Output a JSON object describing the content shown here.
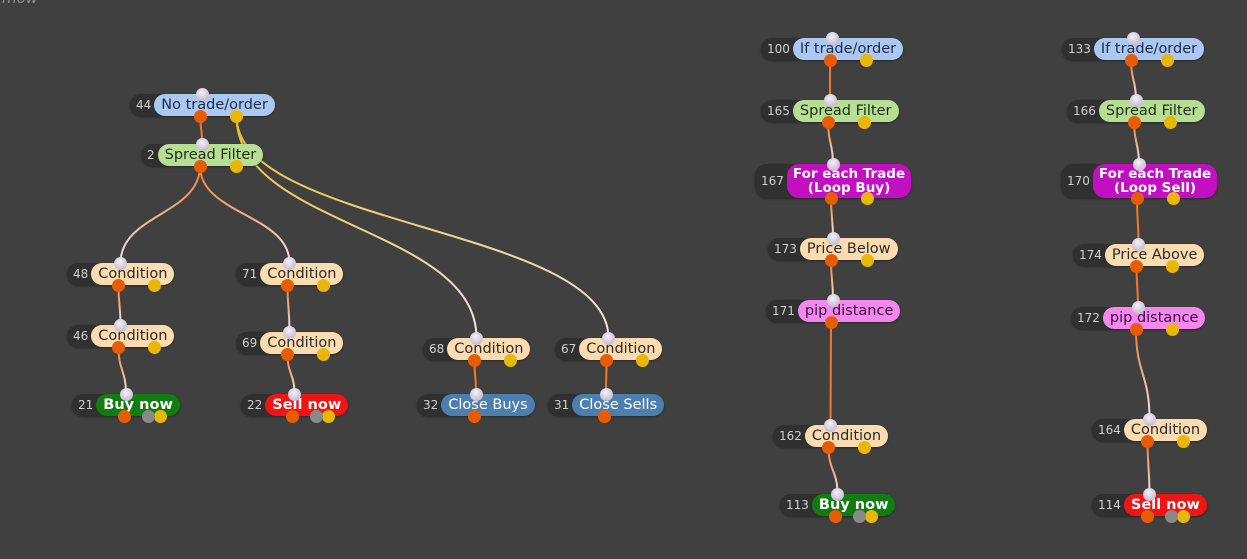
{
  "header": {
    "corner_text": "mow"
  },
  "colors": {
    "canvas": "#404040",
    "node_body": "#303030",
    "wire_main": "#f07a2c",
    "wire_alt": "#e8c020",
    "wire_tip": "#f2e6e6",
    "port_out": "#e85d04",
    "port_alt": "#e9b708"
  },
  "nodes": [
    {
      "key": "n44",
      "id": "44",
      "label": "No trade/order",
      "type": "trade-check",
      "bg": "#abc8f2",
      "fg": "#1f2a44",
      "ports": 2
    },
    {
      "key": "n2",
      "id": "2",
      "label": "Spread Filter",
      "type": "filter",
      "bg": "#b7de95",
      "fg": "#1d2e14",
      "ports": 2
    },
    {
      "key": "n48",
      "id": "48",
      "label": "Condition",
      "type": "condition",
      "bg": "#fbdcb0",
      "fg": "#2b2b2b",
      "ports": 2
    },
    {
      "key": "n46",
      "id": "46",
      "label": "Condition",
      "type": "condition",
      "bg": "#fbdcb0",
      "fg": "#2b2b2b",
      "ports": 2
    },
    {
      "key": "n21",
      "id": "21",
      "label": "Buy now",
      "type": "buy",
      "bg": "#117c11",
      "fg": "#ffffff",
      "bold": true,
      "ports": 3
    },
    {
      "key": "n71",
      "id": "71",
      "label": "Condition",
      "type": "condition",
      "bg": "#fbdcb0",
      "fg": "#2b2b2b",
      "ports": 2
    },
    {
      "key": "n69",
      "id": "69",
      "label": "Condition",
      "type": "condition",
      "bg": "#fbdcb0",
      "fg": "#2b2b2b",
      "ports": 2
    },
    {
      "key": "n22",
      "id": "22",
      "label": "Sell now",
      "type": "sell",
      "bg": "#f01414",
      "fg": "#ffffff",
      "bold": true,
      "ports": 3
    },
    {
      "key": "n68",
      "id": "68",
      "label": "Condition",
      "type": "condition",
      "bg": "#fbdcb0",
      "fg": "#2b2b2b",
      "ports": 2
    },
    {
      "key": "n32",
      "id": "32",
      "label": "Close Buys",
      "type": "close",
      "bg": "#4d7fae",
      "fg": "#ffffff",
      "ports": 1
    },
    {
      "key": "n67",
      "id": "67",
      "label": "Condition",
      "type": "condition",
      "bg": "#fbdcb0",
      "fg": "#2b2b2b",
      "ports": 2
    },
    {
      "key": "n31",
      "id": "31",
      "label": "Close Sells",
      "type": "close",
      "bg": "#4d7fae",
      "fg": "#ffffff",
      "ports": 1
    },
    {
      "key": "n100",
      "id": "100",
      "label": "If trade/order",
      "type": "trade-check",
      "bg": "#abc8f2",
      "fg": "#1f2a44",
      "ports": 2
    },
    {
      "key": "n165",
      "id": "165",
      "label": "Spread Filter",
      "type": "filter",
      "bg": "#b7de95",
      "fg": "#1d2e14",
      "ports": 2
    },
    {
      "key": "n167",
      "id": "167",
      "label_lines": [
        "For each Trade",
        "(Loop Buy)"
      ],
      "type": "loop",
      "bg": "#c20fc2",
      "fg": "#ffffff",
      "tall": true,
      "ports": 2
    },
    {
      "key": "n173",
      "id": "173",
      "label": "Price Below",
      "type": "condition",
      "bg": "#fbdcb0",
      "fg": "#2b2b2b",
      "ports": 2
    },
    {
      "key": "n171",
      "id": "171",
      "label": "pip distance",
      "type": "pip",
      "bg": "#f487f0",
      "fg": "#3a1038",
      "ports": 1
    },
    {
      "key": "n162",
      "id": "162",
      "label": "Condition",
      "type": "condition",
      "bg": "#fbdcb0",
      "fg": "#2b2b2b",
      "ports": 2
    },
    {
      "key": "n113",
      "id": "113",
      "label": "Buy now",
      "type": "buy",
      "bg": "#117c11",
      "fg": "#ffffff",
      "bold": true,
      "ports": 3
    },
    {
      "key": "n133",
      "id": "133",
      "label": "If trade/order",
      "type": "trade-check",
      "bg": "#abc8f2",
      "fg": "#1f2a44",
      "ports": 2
    },
    {
      "key": "n166",
      "id": "166",
      "label": "Spread Filter",
      "type": "filter",
      "bg": "#b7de95",
      "fg": "#1d2e14",
      "ports": 2
    },
    {
      "key": "n170",
      "id": "170",
      "label_lines": [
        "For each Trade",
        "(Loop Sell)"
      ],
      "type": "loop",
      "bg": "#c20fc2",
      "fg": "#ffffff",
      "tall": true,
      "ports": 2
    },
    {
      "key": "n174",
      "id": "174",
      "label": "Price Above",
      "type": "condition",
      "bg": "#fbdcb0",
      "fg": "#2b2b2b",
      "ports": 2
    },
    {
      "key": "n172",
      "id": "172",
      "label": "pip distance",
      "type": "pip",
      "bg": "#f487f0",
      "fg": "#3a1038",
      "ports": 2
    },
    {
      "key": "n164",
      "id": "164",
      "label": "Condition",
      "type": "condition",
      "bg": "#fbdcb0",
      "fg": "#2b2b2b",
      "ports": 2
    },
    {
      "key": "n114",
      "id": "114",
      "label": "Sell now",
      "type": "sell",
      "bg": "#f01414",
      "fg": "#ffffff",
      "bold": true,
      "ports": 3
    }
  ],
  "connections": [
    {
      "from": "n44",
      "to": "n2",
      "port": "main"
    },
    {
      "from": "n2",
      "to": "n48",
      "port": "main"
    },
    {
      "from": "n2",
      "to": "n71",
      "port": "main"
    },
    {
      "from": "n48",
      "to": "n46",
      "port": "main"
    },
    {
      "from": "n46",
      "to": "n21",
      "port": "main"
    },
    {
      "from": "n71",
      "to": "n69",
      "port": "main"
    },
    {
      "from": "n69",
      "to": "n22",
      "port": "main"
    },
    {
      "from": "n44",
      "to": "n68",
      "port": "alt"
    },
    {
      "from": "n44",
      "to": "n67",
      "port": "alt"
    },
    {
      "from": "n68",
      "to": "n32",
      "port": "main"
    },
    {
      "from": "n67",
      "to": "n31",
      "port": "main"
    },
    {
      "from": "n100",
      "to": "n165",
      "port": "main"
    },
    {
      "from": "n165",
      "to": "n167",
      "port": "main"
    },
    {
      "from": "n167",
      "to": "n173",
      "port": "main"
    },
    {
      "from": "n173",
      "to": "n171",
      "port": "main"
    },
    {
      "from": "n171",
      "to": "n162",
      "port": "main"
    },
    {
      "from": "n162",
      "to": "n113",
      "port": "main"
    },
    {
      "from": "n133",
      "to": "n166",
      "port": "main"
    },
    {
      "from": "n166",
      "to": "n170",
      "port": "main"
    },
    {
      "from": "n170",
      "to": "n174",
      "port": "main"
    },
    {
      "from": "n174",
      "to": "n172",
      "port": "main"
    },
    {
      "from": "n172",
      "to": "n164",
      "port": "main"
    },
    {
      "from": "n164",
      "to": "n114",
      "port": "main"
    }
  ]
}
